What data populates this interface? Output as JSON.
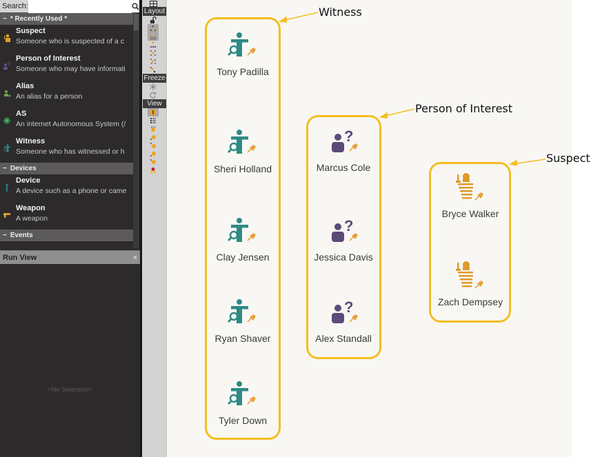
{
  "palette": {
    "search": {
      "label": "Search:",
      "value": "",
      "placeholder": ""
    },
    "sections": [
      {
        "title": "* Recently Used *",
        "items": [
          {
            "title": "Suspect",
            "desc": "Someone who is suspected of a c",
            "icon": "suspect-icon",
            "color": "#e2a22a"
          },
          {
            "title": "Person of Interest",
            "desc": "Someone who may have informati",
            "icon": "person-of-interest-icon",
            "color": "#6a4e8a"
          },
          {
            "title": "Alias",
            "desc": "An alias for a person",
            "icon": "alias-icon",
            "color": "#6aa84f"
          },
          {
            "title": "AS",
            "desc": "An internet Autonomous System (/",
            "icon": "as-icon",
            "color": "#3fbf5f"
          },
          {
            "title": "Witness",
            "desc": "Someone who has witnessed or h",
            "icon": "witness-icon",
            "color": "#2e8a86"
          }
        ]
      },
      {
        "title": "Devices",
        "items": [
          {
            "title": "Device",
            "desc": "A device such as a phone or came",
            "icon": "device-icon",
            "color": "#1f7a78"
          },
          {
            "title": "Weapon",
            "desc": "A weapon",
            "icon": "weapon-icon",
            "color": "#e2a22a"
          }
        ]
      },
      {
        "title": "Events",
        "items": []
      }
    ]
  },
  "runview": {
    "title": "Run View",
    "close": "×",
    "empty": "<No Selection>"
  },
  "toolstrip": {
    "layout": "Layout",
    "freeze": "Freeze",
    "view": "View"
  },
  "graph": {
    "colors": {
      "group_border": "#f5bd1f",
      "witness": "#2e8a86",
      "poi": "#5c4a78",
      "suspect": "#de9a2c",
      "pin": "#e8a13a"
    },
    "groups": [
      {
        "annotation": "Witness",
        "entity_type": "witness",
        "nodes": [
          "Tony Padilla",
          "Sheri Holland",
          "Clay Jensen",
          "Ryan Shaver",
          "Tyler Down"
        ]
      },
      {
        "annotation": "Person of Interest",
        "entity_type": "poi",
        "nodes": [
          "Marcus Cole",
          "Jessica Davis",
          "Alex Standall"
        ]
      },
      {
        "annotation": "Suspect",
        "entity_type": "suspect",
        "nodes": [
          "Bryce Walker",
          "Zach Dempsey"
        ]
      }
    ]
  }
}
